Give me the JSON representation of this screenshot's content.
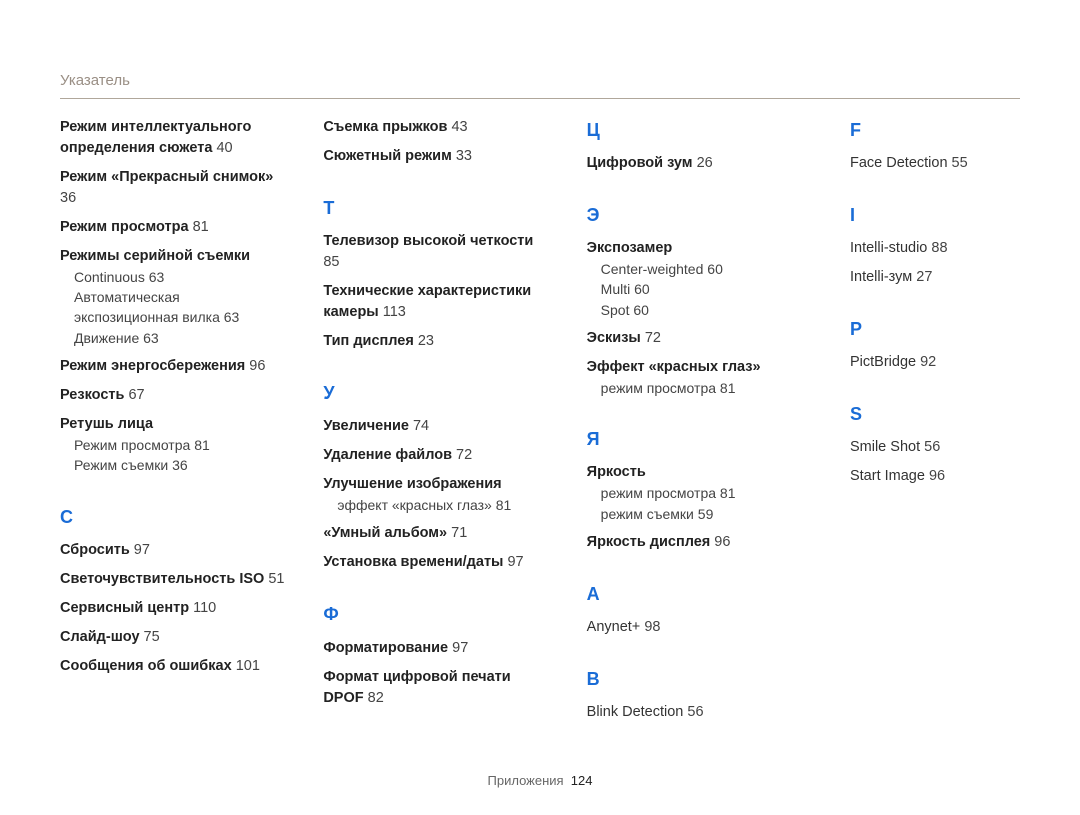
{
  "page_title": "Указатель",
  "footer_label": "Приложения",
  "footer_page": "124",
  "col1": {
    "preEntries": [
      {
        "title": "Режим интеллектуального определения сюжета",
        "pg": "40"
      },
      {
        "title": "Режим «Прекрасный снимок»",
        "pg": "36"
      },
      {
        "title": "Режим просмотра",
        "pg": "81"
      },
      {
        "title": "Режимы серийной съемки",
        "subs": [
          {
            "label": "Continuous",
            "pg": "63"
          },
          {
            "label": "Автоматическая экспозиционная вилка",
            "pg": "63"
          },
          {
            "label": "Движение",
            "pg": "63"
          }
        ]
      },
      {
        "title": "Режим энергосбережения",
        "pg": "96"
      },
      {
        "title": "Резкость",
        "pg": "67"
      },
      {
        "title": "Ретушь лица",
        "subs": [
          {
            "label": "Режим просмотра",
            "pg": "81"
          },
          {
            "label": "Режим съемки",
            "pg": "36"
          }
        ]
      }
    ],
    "letter_c": "С",
    "cEntries": [
      {
        "title": "Сбросить",
        "pg": "97"
      },
      {
        "title": "Светочувствительность ISO",
        "pg": "51"
      },
      {
        "title": "Сервисный центр",
        "pg": "110"
      },
      {
        "title": "Слайд-шоу",
        "pg": "75"
      },
      {
        "title": "Сообщения об ошибках",
        "pg": "101"
      }
    ]
  },
  "col2": {
    "pre": [
      {
        "title": "Съемка прыжков",
        "pg": "43"
      },
      {
        "title": "Сюжетный режим",
        "pg": "33"
      }
    ],
    "letter_t": "Т",
    "t": [
      {
        "title": "Телевизор высокой четкости",
        "pg": "85"
      },
      {
        "title": "Технические характеристики камеры",
        "pg": "113"
      },
      {
        "title": "Тип дисплея",
        "pg": "23"
      }
    ],
    "letter_u": "У",
    "u": [
      {
        "title": "Увеличение",
        "pg": "74"
      },
      {
        "title": "Удаление файлов",
        "pg": "72"
      },
      {
        "title": "Улучшение изображения",
        "subs": [
          {
            "label": "эффект «красных глаз»",
            "pg": "81"
          }
        ]
      },
      {
        "title": "«Умный альбом»",
        "pg": "71"
      },
      {
        "title": "Установка времени/даты",
        "pg": "97"
      }
    ],
    "letter_f": "Ф",
    "f": [
      {
        "title": "Форматирование",
        "pg": "97"
      },
      {
        "title": "Формат цифровой печати DPOF",
        "pg": "82"
      }
    ]
  },
  "col3": {
    "letter_ts": "Ц",
    "ts": [
      {
        "title": "Цифровой зум",
        "pg": "26"
      }
    ],
    "letter_e": "Э",
    "e": [
      {
        "title": "Экспозамер",
        "subs": [
          {
            "label": "Center-weighted",
            "pg": "60"
          },
          {
            "label": "Multi",
            "pg": "60"
          },
          {
            "label": "Spot",
            "pg": "60"
          }
        ]
      },
      {
        "title": "Эскизы",
        "pg": "72"
      },
      {
        "title": "Эффект «красных глаз»",
        "subs": [
          {
            "label": "режим просмотра",
            "pg": "81"
          }
        ]
      }
    ],
    "letter_ya": "Я",
    "ya": [
      {
        "title": "Яркость",
        "subs": [
          {
            "label": "режим просмотра",
            "pg": "81"
          },
          {
            "label": "режим съемки",
            "pg": "59"
          }
        ]
      },
      {
        "title": "Яркость дисплея",
        "pg": "96"
      }
    ],
    "letter_a": "A",
    "a": [
      {
        "plain": "Anynet+",
        "pg": "98"
      }
    ],
    "letter_b": "B",
    "b": [
      {
        "plain": "Blink Detection",
        "pg": "56"
      }
    ]
  },
  "col4": {
    "letter_f": "F",
    "f": [
      {
        "plain": "Face Detection",
        "pg": "55"
      }
    ],
    "letter_i": "I",
    "i": [
      {
        "plain": "Intelli-studio",
        "pg": "88"
      },
      {
        "plain": "Intelli-зум",
        "pg": "27"
      }
    ],
    "letter_p": "P",
    "p": [
      {
        "plain": "PictBridge",
        "pg": "92"
      }
    ],
    "letter_s": "S",
    "s": [
      {
        "plain": "Smile Shot",
        "pg": "56"
      },
      {
        "plain": "Start Image",
        "pg": "96"
      }
    ]
  }
}
